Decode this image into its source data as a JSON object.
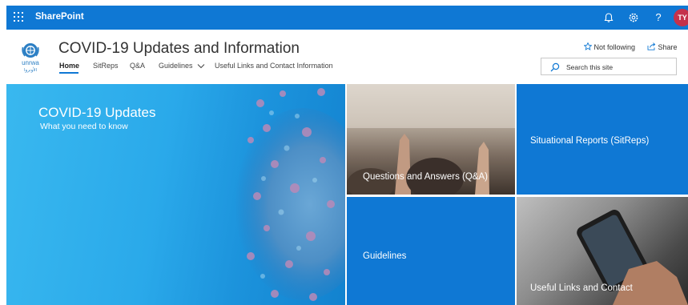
{
  "suite_bar": {
    "brand": "SharePoint",
    "avatar_initials": "TY",
    "help_label": "?",
    "color": "#0f78d4"
  },
  "site": {
    "title": "COVID-19 Updates and Information",
    "logo_text_top": "unrwa",
    "logo_text_bottom": "الأونروا",
    "nav": [
      {
        "label": "Home",
        "active": true
      },
      {
        "label": "SitReps"
      },
      {
        "label": "Q&A"
      },
      {
        "label": "Guidelines",
        "has_dropdown": true
      },
      {
        "label": "Useful Links and Contact Information"
      }
    ],
    "follow_label": "Not following",
    "share_label": "Share",
    "search_placeholder": "Search this site"
  },
  "hero": {
    "main": {
      "title": "COVID-19 Updates",
      "subtitle": "What you need to know"
    },
    "tiles": [
      {
        "label": "Questions and Answers (Q&A)"
      },
      {
        "label": "Situational Reports (SitReps)"
      },
      {
        "label": "Guidelines"
      },
      {
        "label": "Useful Links and Contact"
      }
    ]
  }
}
